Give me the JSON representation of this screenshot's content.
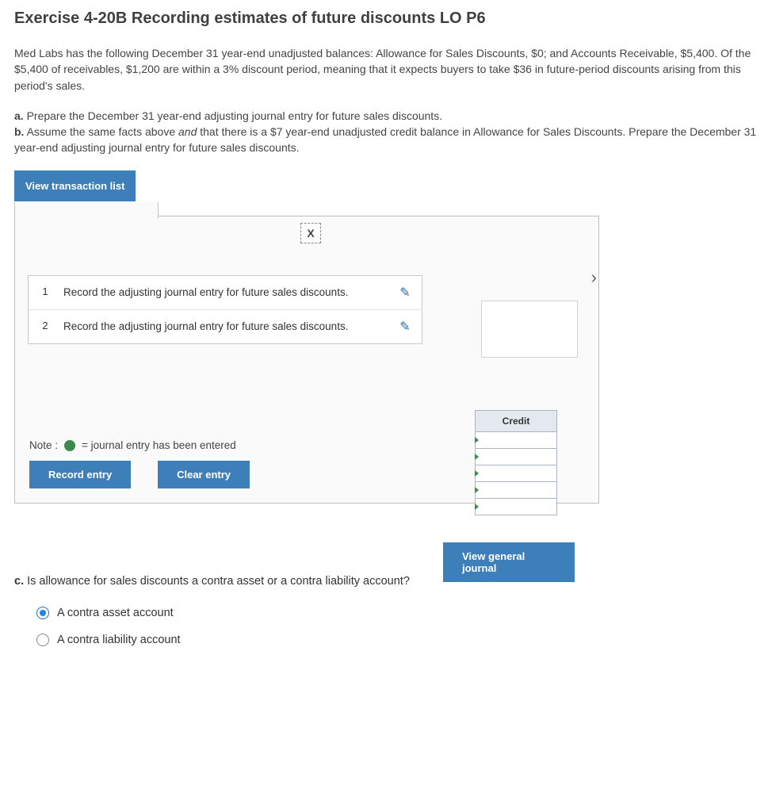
{
  "title": "Exercise 4-20B Recording estimates of future discounts LO P6",
  "intro": "Med Labs has the following December 31 year-end unadjusted balances: Allowance for Sales Discounts, $0; and Accounts Receivable, $5,400. Of the $5,400 of receivables, $1,200 are within a 3% discount period, meaning that it expects buyers to take $36 in future-period discounts arising from this period's sales.",
  "part_a_label": "a.",
  "part_a_text": " Prepare the December 31 year-end adjusting journal entry for future sales discounts.",
  "part_b_label": "b.",
  "part_b_text_1": " Assume the same facts above ",
  "part_b_text_em": "and",
  "part_b_text_2": " that there is a $7 year-end unadjusted credit balance in Allowance for Sales Discounts. Prepare the December 31 year-end adjusting journal entry for future sales discounts.",
  "view_tx": "View transaction list",
  "rows": [
    {
      "n": "1",
      "text": "Record the adjusting journal entry for future sales discounts."
    },
    {
      "n": "2",
      "text": "Record the adjusting journal entry for future sales discounts."
    }
  ],
  "note_label": "Note :",
  "note_text": "= journal entry has been entered",
  "btn_record": "Record entry",
  "btn_clear": "Clear entry",
  "btn_vgj": "View general journal",
  "close_glyph": "X",
  "next_glyph": "›",
  "credit_header": "Credit",
  "partc_label": "c.",
  "partc_q": " Is allowance for sales discounts a contra asset or a contra liability account?",
  "opt1": "A contra asset account",
  "opt2": "A contra liability account"
}
